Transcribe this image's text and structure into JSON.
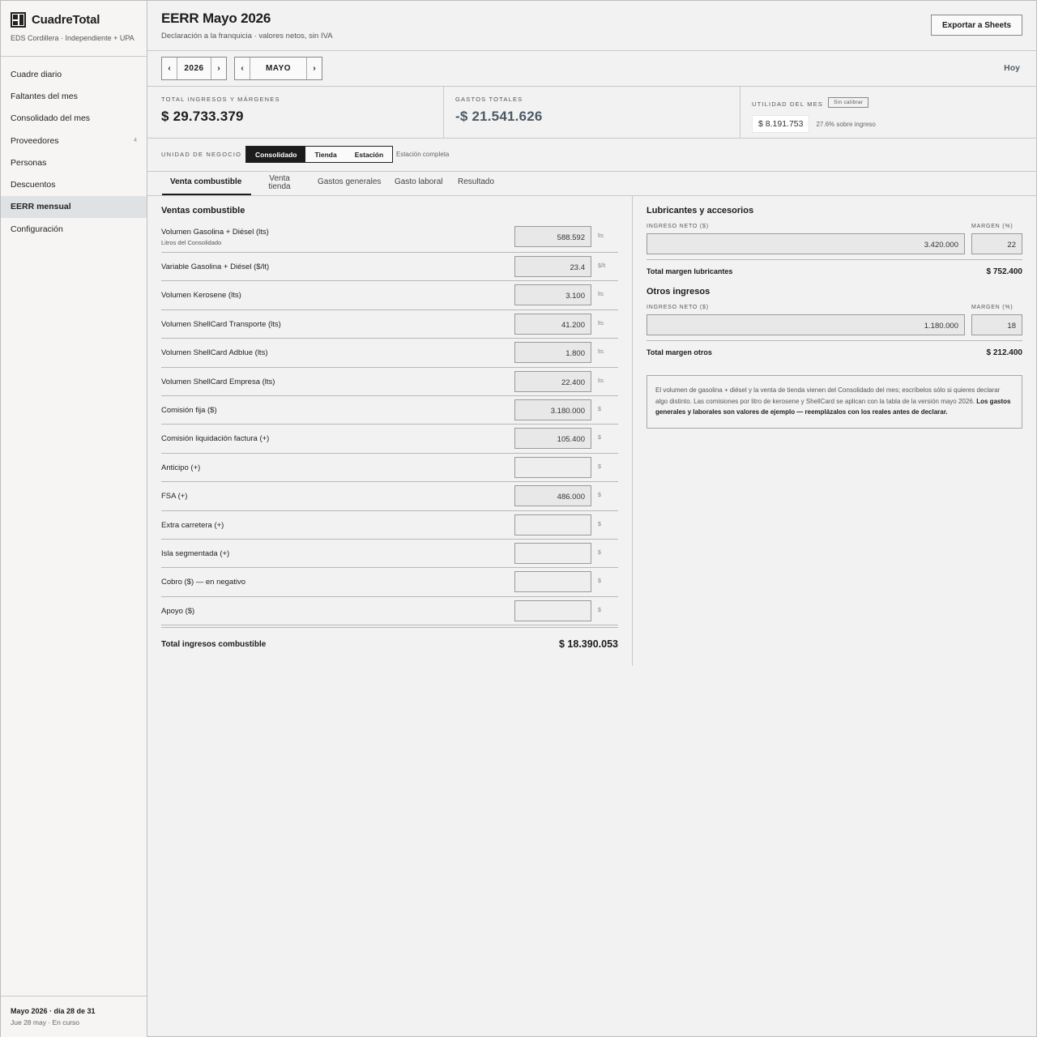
{
  "app": {
    "name": "CuadreTotal",
    "subtitle": "EDS Cordillera · Independiente + UPA"
  },
  "sidebar": {
    "items": [
      {
        "label": "Cuadre diario"
      },
      {
        "label": "Faltantes del mes"
      },
      {
        "label": "Consolidado del mes"
      },
      {
        "label": "Proveedores",
        "badge": "4"
      },
      {
        "label": "Personas"
      },
      {
        "label": "Descuentos"
      },
      {
        "label": "EERR mensual",
        "active": true
      },
      {
        "label": "Configuración"
      }
    ],
    "footer": {
      "title": "Mayo 2026 · día 28 de 31",
      "sub": "Jue 28 may · En curso"
    }
  },
  "header": {
    "title": "EERR Mayo 2026",
    "subtitle": "Declaración a la franquicia · valores netos, sin IVA",
    "export_label": "Exportar a Sheets"
  },
  "period": {
    "year": "2026",
    "month": "MAYO",
    "prev": "‹",
    "next": "›",
    "today_label": "Hoy"
  },
  "kpis": {
    "income_label": "Total ingresos y márgenes",
    "income_value": "$ 29.733.379",
    "expenses_label": "Gastos totales",
    "expenses_value": "-$ 21.541.626",
    "profit_label": "Utilidad del mes",
    "profit_badge": "Sin calibrar",
    "profit_value": "$ 8.191.753",
    "profit_pct": "27.6% sobre ingreso"
  },
  "unit": {
    "label": "Unidad de negocio",
    "options": [
      "Consolidado",
      "Tienda",
      "Estación"
    ],
    "note": "Estación completa"
  },
  "tabs": [
    "Venta combustible",
    "Venta tienda",
    "Gastos generales",
    "Gasto laboral",
    "Resultado"
  ],
  "fuel": {
    "title": "Ventas combustible",
    "rows": [
      {
        "label": "Volumen Gasolina + Diésel (lts)",
        "sub": "Litros del Consolidado",
        "value": "588.592",
        "unit": "lts"
      },
      {
        "label": "Variable Gasolina + Diésel ($/lt)",
        "value": "23.4",
        "unit": "$/lt"
      },
      {
        "label": "Volumen Kerosene (lts)",
        "value": "3.100",
        "unit": "lts"
      },
      {
        "label": "Volumen ShellCard Transporte (lts)",
        "value": "41.200",
        "unit": "lts"
      },
      {
        "label": "Volumen ShellCard Adblue (lts)",
        "value": "1.800",
        "unit": "lts"
      },
      {
        "label": "Volumen ShellCard Empresa (lts)",
        "value": "22.400",
        "unit": "lts"
      },
      {
        "label": "Comisión fija ($)",
        "value": "3.180.000",
        "unit": "$"
      },
      {
        "label": "Comisión liquidación factura (+)",
        "value": "105.400",
        "unit": "$"
      },
      {
        "label": "Anticipo (+)",
        "value": "",
        "unit": "$"
      },
      {
        "label": "FSA (+)",
        "value": "486.000",
        "unit": "$"
      },
      {
        "label": "Extra carretera (+)",
        "value": "",
        "unit": "$"
      },
      {
        "label": "Isla segmentada (+)",
        "value": "",
        "unit": "$"
      },
      {
        "label": "Cobro ($) — en negativo",
        "value": "",
        "unit": "$"
      },
      {
        "label": "Apoyo ($)",
        "value": "",
        "unit": "$"
      }
    ],
    "total_label": "Total ingresos combustible",
    "total_value": "$ 18.390.053"
  },
  "lubricants": {
    "title": "Lubricantes y accesorios",
    "income_head": "Ingreso neto ($)",
    "margin_head": "Margen (%)",
    "income": "3.420.000",
    "margin": "22",
    "total_label": "Total margen lubricantes",
    "total_value": "$ 752.400"
  },
  "other": {
    "title": "Otros ingresos",
    "income_head": "Ingreso neto ($)",
    "margin_head": "Margen (%)",
    "income": "1.180.000",
    "margin": "18",
    "total_label": "Total margen otros",
    "total_value": "$ 212.400"
  },
  "note": {
    "text": "El volumen de gasolina + diésel y la venta de tienda vienen del Consolidado del mes; escríbelos sólo si quieres declarar algo distinto. Las comisiones por litro de kerosene y ShellCard se aplican con la tabla de la versión mayo 2026. ",
    "bold": "Los gastos generales y laborales son valores de ejemplo — reemplázalos con los reales antes de declarar."
  }
}
